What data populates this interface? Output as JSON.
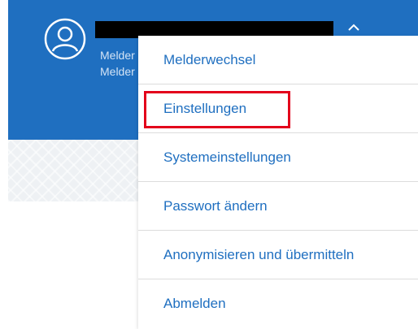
{
  "header": {
    "meta_line_1": "Melder",
    "meta_line_2": "Melder"
  },
  "menu": {
    "items": [
      {
        "label": "Melderwechsel"
      },
      {
        "label": "Einstellungen"
      },
      {
        "label": "Systemeinstellungen"
      },
      {
        "label": "Passwort ändern"
      },
      {
        "label": "Anonymisieren und übermitteln"
      },
      {
        "label": "Abmelden"
      }
    ]
  },
  "colors": {
    "header_blue": "#1f6fc0",
    "link_blue": "#1f6fc0",
    "highlight_red": "#e3001b"
  }
}
